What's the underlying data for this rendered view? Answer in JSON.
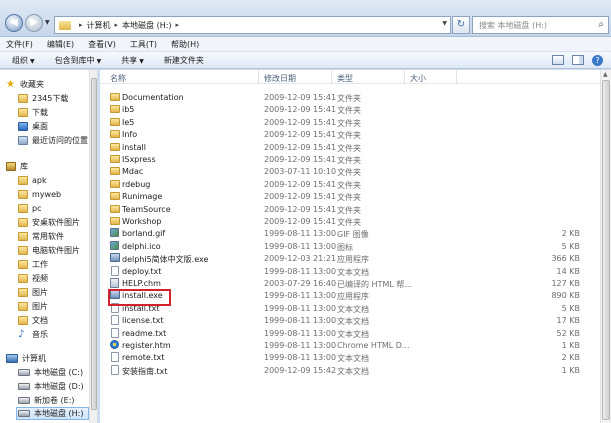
{
  "address": {
    "crumbs": [
      "计算机",
      "本地磁盘 (H:)"
    ],
    "search_placeholder": "搜索 本地磁盘 (H:)"
  },
  "menu": [
    "文件(F)",
    "编辑(E)",
    "查看(V)",
    "工具(T)",
    "帮助(H)"
  ],
  "toolbar": {
    "organize": "组织",
    "include_library": "包含到库中",
    "share": "共享",
    "new_folder": "新建文件夹"
  },
  "nav": {
    "favorites": "收藏夹",
    "fav_items": [
      "2345下载",
      "下载",
      "桌面",
      "最近访问的位置"
    ],
    "libraries": "库",
    "lib_items": [
      "apk",
      "myweb",
      "pc",
      "安桌软件图片",
      "常用软件",
      "电脑软件图片",
      "工作",
      "视频",
      "图片",
      "图片",
      "文档",
      "音乐"
    ],
    "computer": "计算机",
    "drives": [
      "本地磁盘 (C:)",
      "本地磁盘 (D:)",
      "新加卷 (E:)",
      "本地磁盘 (H:)"
    ]
  },
  "columns": {
    "name": "名称",
    "date": "修改日期",
    "type": "类型",
    "size": "大小"
  },
  "files": [
    {
      "icon": "folder",
      "name": "Documentation",
      "date": "2009-12-09 15:41",
      "type": "文件夹",
      "size": ""
    },
    {
      "icon": "folder",
      "name": "ib5",
      "date": "2009-12-09 15:41",
      "type": "文件夹",
      "size": ""
    },
    {
      "icon": "folder",
      "name": "Ie5",
      "date": "2009-12-09 15:41",
      "type": "文件夹",
      "size": ""
    },
    {
      "icon": "folder",
      "name": "Info",
      "date": "2009-12-09 15:41",
      "type": "文件夹",
      "size": ""
    },
    {
      "icon": "folder",
      "name": "install",
      "date": "2009-12-09 15:41",
      "type": "文件夹",
      "size": ""
    },
    {
      "icon": "folder",
      "name": "ISxpress",
      "date": "2009-12-09 15:41",
      "type": "文件夹",
      "size": ""
    },
    {
      "icon": "folder",
      "name": "Mdac",
      "date": "2003-07-11 10:10",
      "type": "文件夹",
      "size": ""
    },
    {
      "icon": "folder",
      "name": "rdebug",
      "date": "2009-12-09 15:41",
      "type": "文件夹",
      "size": ""
    },
    {
      "icon": "folder",
      "name": "Runimage",
      "date": "2009-12-09 15:41",
      "type": "文件夹",
      "size": ""
    },
    {
      "icon": "folder",
      "name": "TeamSource",
      "date": "2009-12-09 15:41",
      "type": "文件夹",
      "size": ""
    },
    {
      "icon": "folder",
      "name": "Workshop",
      "date": "2009-12-09 15:41",
      "type": "文件夹",
      "size": ""
    },
    {
      "icon": "image",
      "name": "borland.gif",
      "date": "1999-08-11 13:00",
      "type": "GIF 图像",
      "size": "2 KB"
    },
    {
      "icon": "image",
      "name": "delphi.ico",
      "date": "1999-08-11 13:00",
      "type": "图标",
      "size": "5 KB"
    },
    {
      "icon": "exe",
      "name": "delphi5简体中文版.exe",
      "date": "2009-12-03 21:21",
      "type": "应用程序",
      "size": "366 KB"
    },
    {
      "icon": "file",
      "name": "deploy.txt",
      "date": "1999-08-11 13:00",
      "type": "文本文档",
      "size": "14 KB"
    },
    {
      "icon": "help",
      "name": "HELP.chm",
      "date": "2003-07-29 16:40",
      "type": "已编译的 HTML 帮...",
      "size": "127 KB"
    },
    {
      "icon": "exe",
      "name": "install.exe",
      "date": "1999-08-11 13:00",
      "type": "应用程序",
      "size": "890 KB"
    },
    {
      "icon": "file",
      "name": "install.txt",
      "date": "1999-08-11 13:00",
      "type": "文本文档",
      "size": "5 KB"
    },
    {
      "icon": "file",
      "name": "license.txt",
      "date": "1999-08-11 13:00",
      "type": "文本文档",
      "size": "17 KB"
    },
    {
      "icon": "file",
      "name": "readme.txt",
      "date": "1999-08-11 13:00",
      "type": "文本文档",
      "size": "52 KB"
    },
    {
      "icon": "htm",
      "name": "register.htm",
      "date": "1999-08-11 13:00",
      "type": "Chrome HTML D...",
      "size": "1 KB"
    },
    {
      "icon": "file",
      "name": "remote.txt",
      "date": "1999-08-11 13:00",
      "type": "文本文档",
      "size": "2 KB"
    },
    {
      "icon": "file",
      "name": "安装指南.txt",
      "date": "2009-12-09 15:42",
      "type": "文本文档",
      "size": "1 KB"
    }
  ],
  "highlighted_file": "install.exe",
  "colors": {
    "highlight_border": "#d2232a",
    "selection": "#cce3fb"
  }
}
